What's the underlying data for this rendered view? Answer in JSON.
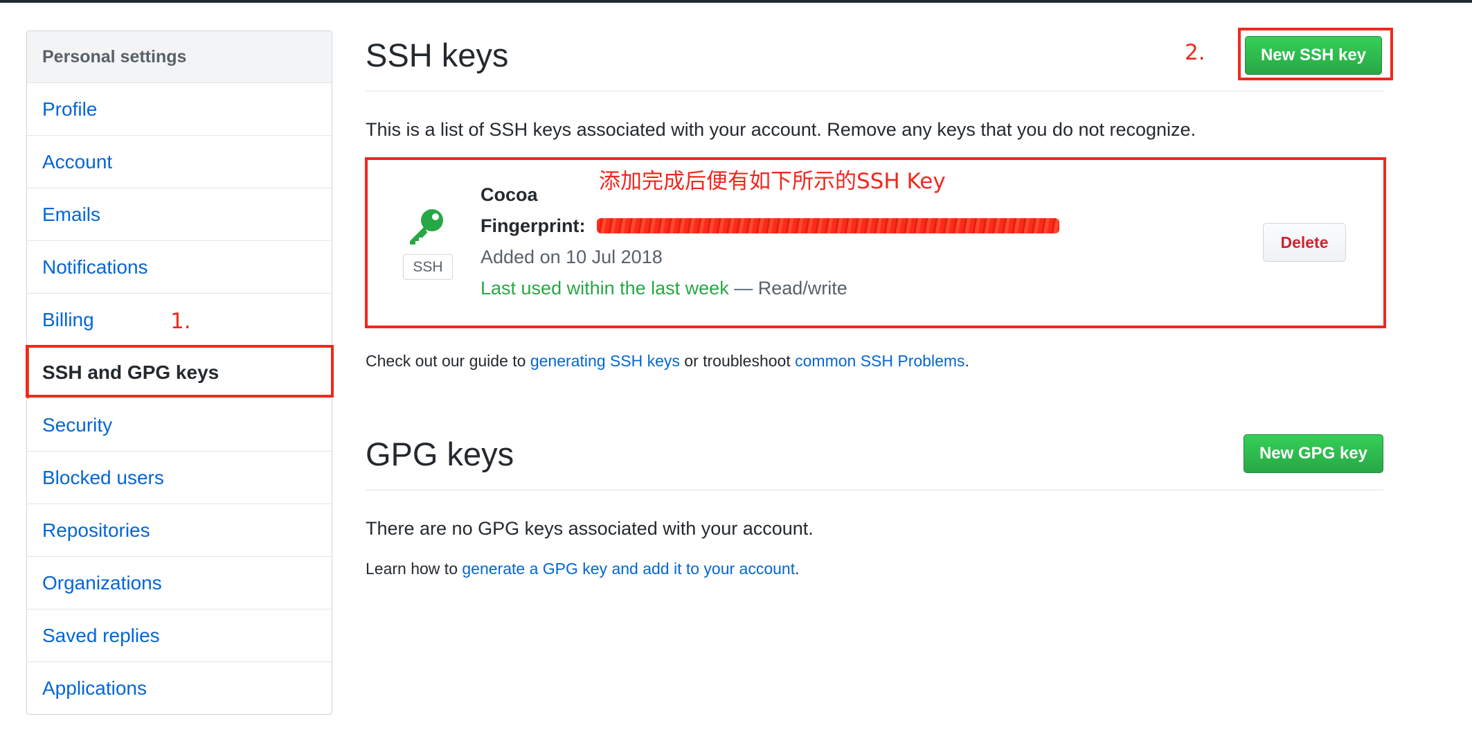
{
  "sidebar": {
    "header": "Personal settings",
    "items": [
      {
        "label": "Profile"
      },
      {
        "label": "Account"
      },
      {
        "label": "Emails"
      },
      {
        "label": "Notifications"
      },
      {
        "label": "Billing"
      },
      {
        "label": "SSH and GPG keys",
        "selected": true
      },
      {
        "label": "Security"
      },
      {
        "label": "Blocked users"
      },
      {
        "label": "Repositories"
      },
      {
        "label": "Organizations"
      },
      {
        "label": "Saved replies"
      },
      {
        "label": "Applications"
      }
    ]
  },
  "annotations": {
    "step1": "1.",
    "step2": "2.",
    "key_note": "添加完成后便有如下所示的SSH Key"
  },
  "ssh": {
    "title": "SSH keys",
    "new_button": "New SSH key",
    "intro": "This is a list of SSH keys associated with your account. Remove any keys that you do not recognize.",
    "key": {
      "badge": "SSH",
      "icon": "key-icon",
      "name": "Cocoa",
      "fingerprint_label": "Fingerprint:",
      "added": "Added on 10 Jul 2018",
      "last_used": "Last used within the last week",
      "access": " — Read/write",
      "delete_button": "Delete"
    },
    "guide": {
      "prefix": "Check out our guide to ",
      "link1": "generating SSH keys",
      "middle": " or troubleshoot ",
      "link2": "common SSH Problems",
      "suffix": "."
    }
  },
  "gpg": {
    "title": "GPG keys",
    "new_button": "New GPG key",
    "empty": "There are no GPG keys associated with your account.",
    "learn": {
      "prefix": "Learn how to ",
      "link": "generate a GPG key and add it to your account",
      "suffix": "."
    }
  },
  "colors": {
    "accent_green": "#28a745",
    "link_blue": "#0366d6",
    "annotation_red": "#f0281e",
    "danger_red": "#cb2431"
  }
}
